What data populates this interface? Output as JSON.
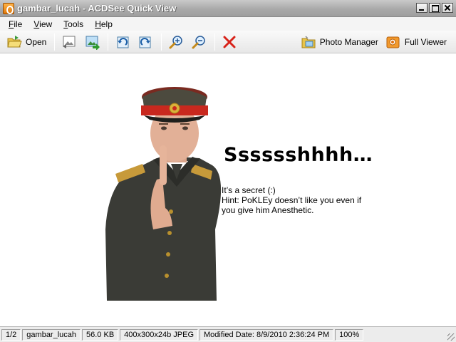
{
  "window": {
    "title": "gambar_lucah - ACDSee Quick View"
  },
  "menu": {
    "items": [
      {
        "label": "File",
        "accel": "F",
        "rest": "ile"
      },
      {
        "label": "View",
        "accel": "V",
        "rest": "iew"
      },
      {
        "label": "Tools",
        "accel": "T",
        "rest": "ools"
      },
      {
        "label": "Help",
        "accel": "H",
        "rest": "elp"
      }
    ]
  },
  "toolbar": {
    "open_label": "Open",
    "photo_manager_label": "Photo Manager",
    "full_viewer_label": "Full Viewer",
    "icons": [
      "open-folder-icon",
      "previous-image-icon",
      "next-image-icon",
      "rotate-left-icon",
      "rotate-right-icon",
      "zoom-in-icon",
      "zoom-out-icon",
      "delete-icon",
      "photo-manager-icon",
      "full-viewer-icon"
    ]
  },
  "image": {
    "headline": "Sssssshhhh…",
    "caption_line1": "It’s a secret (:)",
    "caption_line2": "Hint: PoKLEy doesn’t like you  even if",
    "caption_line3": "you give him Anesthetic."
  },
  "status": {
    "index": "1/2",
    "filename": "gambar_lucah",
    "size": "56.0 KB",
    "dimensions": "400x300x24b JPEG",
    "modified": "Modified Date: 8/9/2010 2:36:24 PM",
    "zoom": "100%"
  },
  "colors": {
    "delete_red": "#d8231a",
    "titlebar_gray": "#a9a9a9",
    "cap_red": "#c8281e"
  }
}
